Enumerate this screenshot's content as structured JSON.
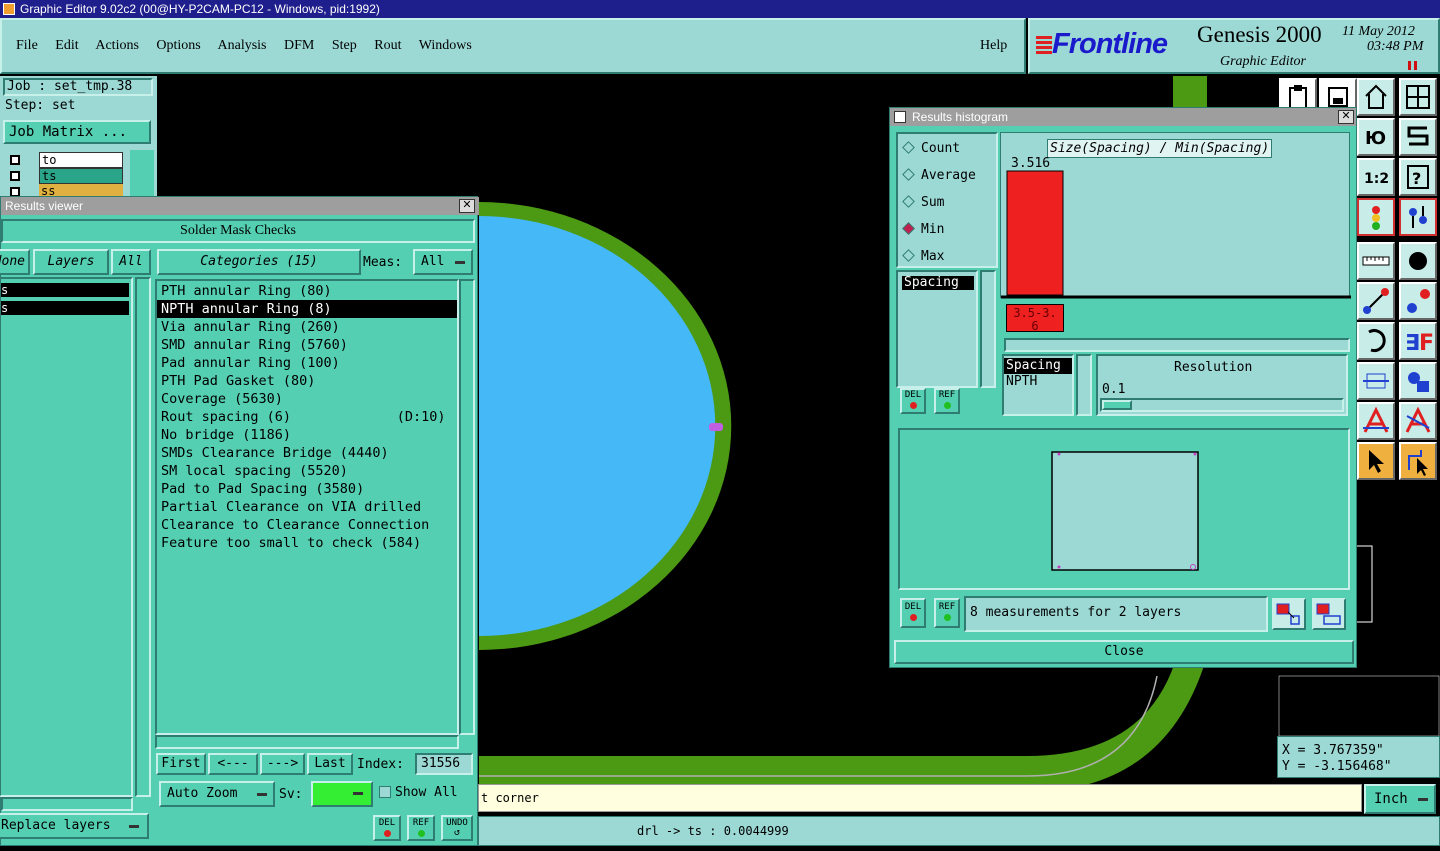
{
  "window": {
    "title": "Graphic Editor 9.02c2 (00@HY-P2CAM-PC12 - Windows, pid:1992)"
  },
  "menu": [
    "File",
    "Edit",
    "Actions",
    "Options",
    "Analysis",
    "DFM",
    "Step",
    "Rout",
    "Windows"
  ],
  "help": "Help",
  "brand": {
    "logo": "Frontline",
    "product": "Genesis 2000",
    "subtitle": "Graphic Editor",
    "date": "11 May 2012",
    "time": "03:48 PM"
  },
  "job": {
    "job_label": "Job : set_tmp.38",
    "step_label": "Step: set",
    "matrix_button": "Job Matrix ..."
  },
  "layers_mini": [
    "to",
    "ts",
    "ss"
  ],
  "results_viewer": {
    "title": "Results viewer",
    "heading": "Solder Mask Checks",
    "none_btn": "None",
    "layers_btn": "Layers",
    "all_btn": "All",
    "categories_btn": "Categories (15)",
    "meas_label": "Meas:",
    "meas_value": "All",
    "categories": [
      "PTH annular Ring (80)",
      "NPTH annular Ring (8)",
      "Via annular Ring (260)",
      "SMD annular Ring (5760)",
      "Pad annular Ring (100)",
      "PTH Pad Gasket (80)",
      "Coverage (5630)",
      "Rout spacing (6)             (D:10)",
      "No bridge (1186)",
      "SMDs Clearance Bridge (4440)",
      "SM local spacing (5520)",
      "Pad to Pad Spacing (3580)",
      "Partial Clearance on VIA drilled",
      "Clearance to Clearance Connection",
      "Feature too small to check (584)"
    ],
    "selected_index": 1,
    "first": "First",
    "prev": "<---",
    "next": "--->",
    "last": "Last",
    "index_label": "Index:",
    "index_value": "31556",
    "auto_zoom": "Auto Zoom",
    "sv_label": "Sv:",
    "show_all": "Show All",
    "replace_layers": "Replace layers",
    "del": "DEL",
    "ref": "REF",
    "undo": "UNDO"
  },
  "histogram": {
    "title": "Results histogram",
    "modes": [
      "Count",
      "Average",
      "Sum",
      "Min",
      "Max"
    ],
    "selected_mode": "Min",
    "chart_title": "Size(Spacing) / Min(Spacing)",
    "bar_value": "3.516",
    "bar_range": "3.5-3.6",
    "list_item": "Spacing",
    "group_item": "Spacing",
    "sub_item": "NPTH",
    "resolution_label": "Resolution",
    "resolution_value": "0.1",
    "status": "8 measurements for 2 layers",
    "close": "Close",
    "del": "DEL",
    "ref": "REF"
  },
  "chart_data": {
    "type": "bar",
    "title": "Size(Spacing) / Min(Spacing)",
    "categories": [
      "3.5-3.6"
    ],
    "values": [
      3.516
    ]
  },
  "coords": {
    "x": "X = 3.767359\"",
    "y": "Y = -3.156468\""
  },
  "message": "t corner",
  "status_line": "drl -> ts : 0.0044999",
  "units": "Inch",
  "colors": {
    "panel": "#55cfb2",
    "light": "#9cd9d5",
    "pad_fill": "#45b8f8",
    "pad_ring": "#4c9a14",
    "bar": "#ee2020"
  }
}
